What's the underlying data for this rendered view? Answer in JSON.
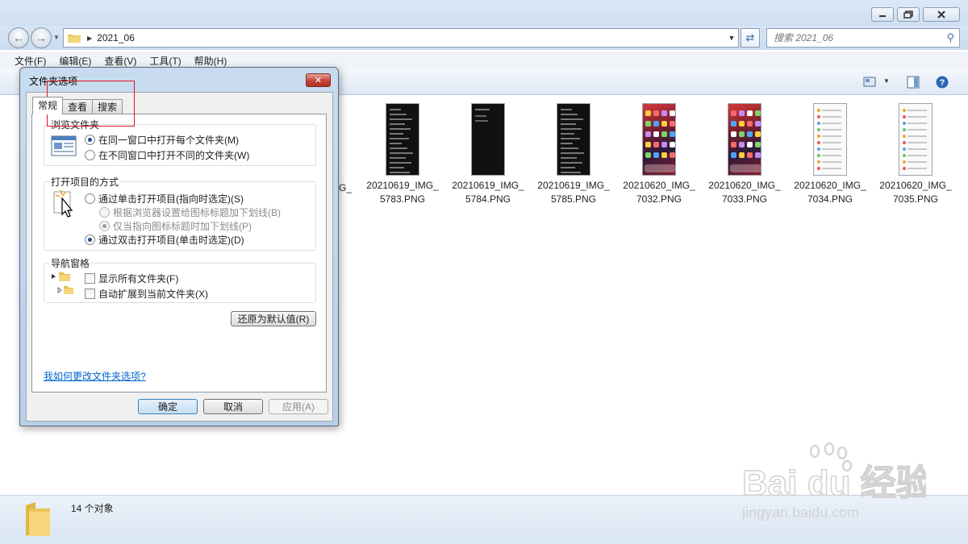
{
  "explorer": {
    "address": {
      "current_folder": "2021_06"
    },
    "search": {
      "placeholder": "搜索 2021_06"
    },
    "menu": [
      "文件(F)",
      "编辑(E)",
      "查看(V)",
      "工具(T)",
      "帮助(H)"
    ],
    "partial_label": "G_",
    "files": [
      {
        "line1": "20210619_IMG_",
        "line2": "5783.PNG",
        "style": "dark-settings"
      },
      {
        "line1": "20210619_IMG_",
        "line2": "5784.PNG",
        "style": "dark-blank"
      },
      {
        "line1": "20210619_IMG_",
        "line2": "5785.PNG",
        "style": "dark-settings"
      },
      {
        "line1": "20210620_IMG_",
        "line2": "7032.PNG",
        "style": "homescreen"
      },
      {
        "line1": "20210620_IMG_",
        "line2": "7033.PNG",
        "style": "homescreen"
      },
      {
        "line1": "20210620_IMG_",
        "line2": "7034.PNG",
        "style": "light-list"
      },
      {
        "line1": "20210620_IMG_",
        "line2": "7035.PNG",
        "style": "light-list"
      }
    ],
    "status": {
      "item_count": "14 个对象"
    }
  },
  "dialog": {
    "title": "文件夹选项",
    "tabs": [
      "常规",
      "查看",
      "搜索"
    ],
    "browse_group": {
      "title": "浏览文件夹",
      "options": [
        "在同一窗口中打开每个文件夹(M)",
        "在不同窗口中打开不同的文件夹(W)"
      ],
      "selected": 0
    },
    "click_group": {
      "title": "打开项目的方式",
      "single_click": "通过单击打开项目(指向时选定)(S)",
      "underline_browser": "根据浏览器设置给图标标题加下划线(B)",
      "underline_point": "仅当指向图标标题时加下划线(P)",
      "double_click": "通过双击打开项目(单击时选定)(D)",
      "selected": "double_click"
    },
    "nav_group": {
      "title": "导航窗格",
      "show_all": "显示所有文件夹(F)",
      "auto_expand": "自动扩展到当前文件夹(X)"
    },
    "restore_button": "还原为默认值(R)",
    "help_link": "我如何更改文件夹选项?",
    "buttons": {
      "ok": "确定",
      "cancel": "取消",
      "apply": "应用(A)"
    }
  },
  "watermark": {
    "brand": "Bai du 经验",
    "url": "jingyan.baidu.com"
  }
}
